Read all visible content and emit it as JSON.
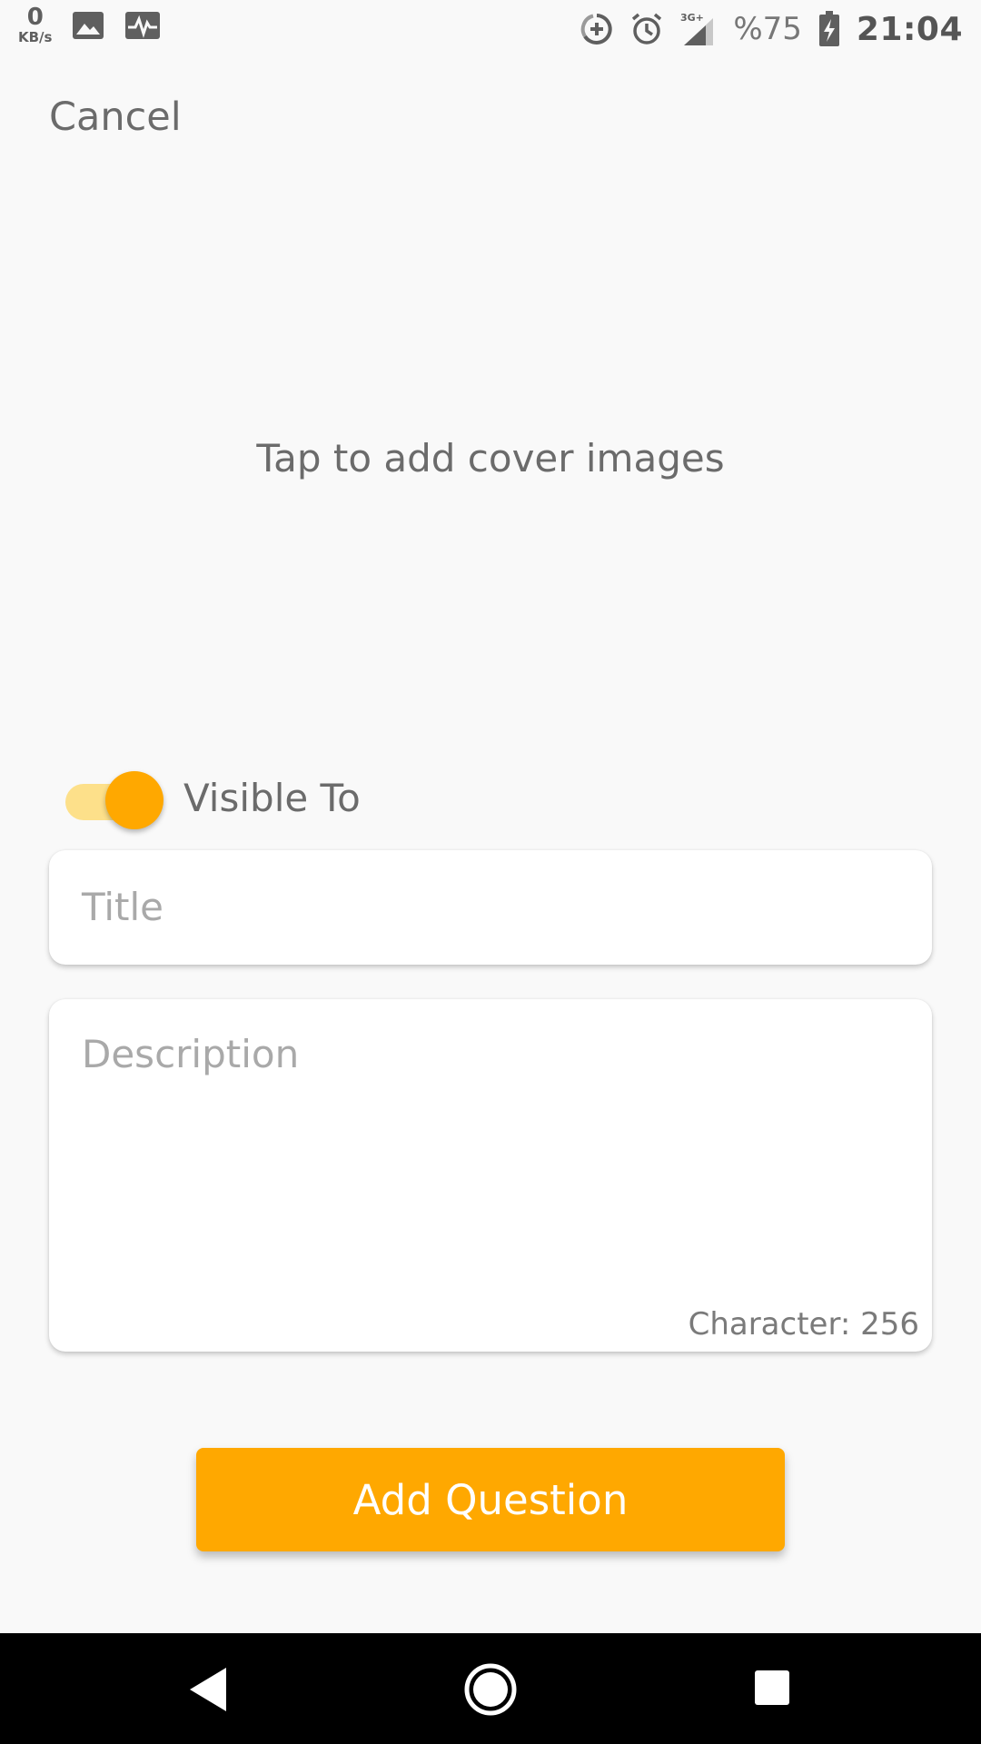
{
  "status_bar": {
    "net_speed_value": "0",
    "net_speed_unit": "KB/s",
    "icons_left": [
      "gallery-icon",
      "activity-icon"
    ],
    "icons_right": [
      "data-saver-icon",
      "alarm-icon",
      "signal-3g-icon",
      "battery-charging-icon"
    ],
    "network_type": "3G+",
    "battery_percent": "%75",
    "time": "21:04"
  },
  "header": {
    "cancel_label": "Cancel"
  },
  "cover": {
    "prompt": "Tap to add cover images"
  },
  "visibility": {
    "label": "Visible To",
    "enabled": true
  },
  "form": {
    "title_placeholder": "Title",
    "description_placeholder": "Description",
    "character_count": "Character: 256"
  },
  "actions": {
    "submit_label": "Add Question"
  },
  "colors": {
    "accent": "#ffa800",
    "toggle_track": "#fde08a",
    "background": "#f9f9f9"
  }
}
